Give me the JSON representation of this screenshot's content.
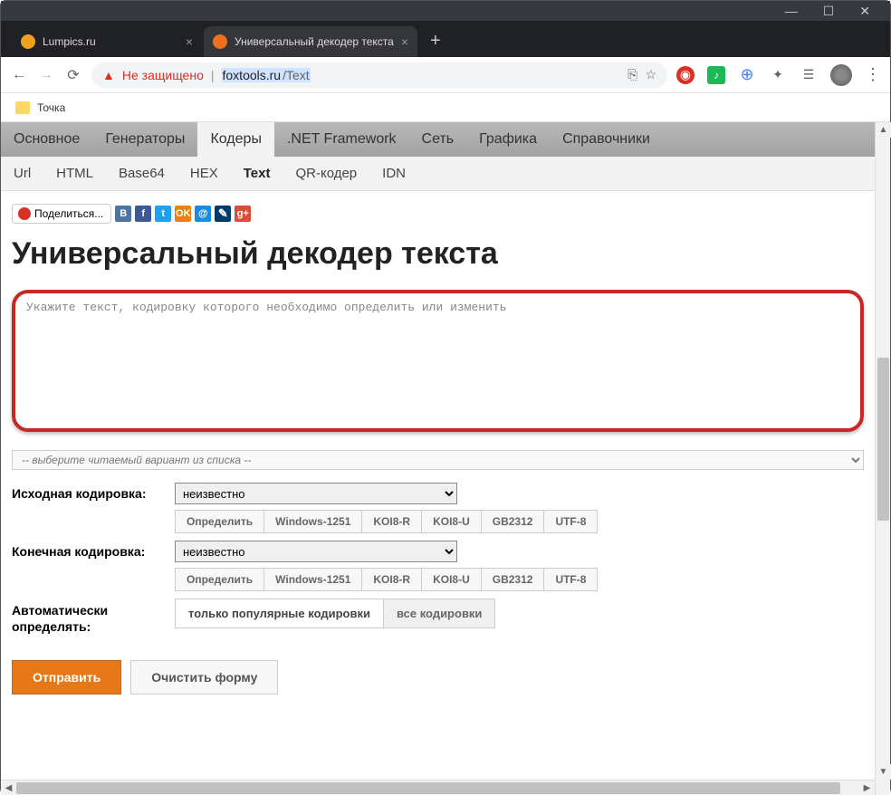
{
  "window": {
    "minimize": "—",
    "maximize": "☐",
    "close": "✕"
  },
  "tabs": [
    {
      "title": "Lumpics.ru",
      "favicon_color": "#f0a020"
    },
    {
      "title": "Универсальный декодер текста",
      "favicon_color": "#f07020"
    }
  ],
  "address": {
    "warn_label": "Не защищено",
    "url_host": "foxtools.ru",
    "url_path": "/Text"
  },
  "bookmarks": {
    "item1": "Точка"
  },
  "mainnav": {
    "items": [
      "Основное",
      "Генераторы",
      "Кодеры",
      ".NET Framework",
      "Сеть",
      "Графика",
      "Справочники"
    ],
    "active_index": 2
  },
  "subnav": {
    "items": [
      "Url",
      "HTML",
      "Base64",
      "HEX",
      "Text",
      "QR-кодер",
      "IDN"
    ],
    "active_index": 4
  },
  "share": {
    "label": "Поделиться..."
  },
  "page": {
    "title": "Универсальный декодер текста"
  },
  "input": {
    "placeholder": "Укажите текст, кодировку которого необходимо определить или изменить"
  },
  "variant": {
    "placeholder": "-- выберите читаемый вариант из списка --"
  },
  "form": {
    "source_label": "Исходная кодировка:",
    "target_label": "Конечная кодировка:",
    "auto_label": "Автоматически определять:",
    "unknown_option": "неизвестно",
    "enc_buttons": [
      "Определить",
      "Windows-1251",
      "KOI8-R",
      "KOI8-U",
      "GB2312",
      "UTF-8"
    ],
    "toggle": {
      "popular": "только популярные кодировки",
      "all": "все кодировки"
    }
  },
  "actions": {
    "submit": "Отправить",
    "clear": "Очистить форму"
  }
}
